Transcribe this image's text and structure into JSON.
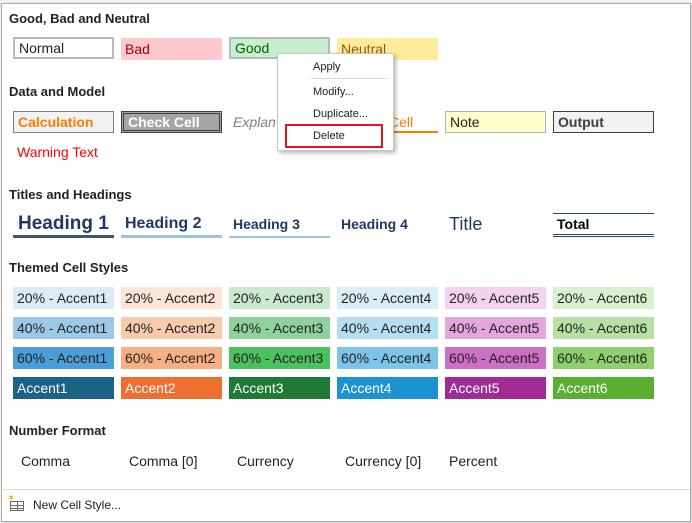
{
  "sections": {
    "good_bad_neutral": "Good, Bad and Neutral",
    "data_model": "Data and Model",
    "titles_headings": "Titles and Headings",
    "themed": "Themed Cell Styles",
    "number_format": "Number Format"
  },
  "good_bad_neutral": [
    "Normal",
    "Bad",
    "Good",
    "Neutral"
  ],
  "data_model": {
    "row1": [
      "Calculation",
      "Check Cell",
      "Explan",
      "Cell",
      "Note",
      "Output"
    ],
    "row2": [
      "Warning Text"
    ]
  },
  "titles": [
    "Heading 1",
    "Heading 2",
    "Heading 3",
    "Heading 4",
    "Title",
    "Total"
  ],
  "themed": {
    "pct20": [
      "20% - Accent1",
      "20% - Accent2",
      "20% - Accent3",
      "20% - Accent4",
      "20% - Accent5",
      "20% - Accent6"
    ],
    "pct40": [
      "40% - Accent1",
      "40% - Accent2",
      "40% - Accent3",
      "40% - Accent4",
      "40% - Accent5",
      "40% - Accent6"
    ],
    "pct60": [
      "60% - Accent1",
      "60% - Accent2",
      "60% - Accent3",
      "60% - Accent4",
      "60% - Accent5",
      "60% - Accent6"
    ],
    "accent": [
      "Accent1",
      "Accent2",
      "Accent3",
      "Accent4",
      "Accent5",
      "Accent6"
    ]
  },
  "number_format": [
    "Comma",
    "Comma [0]",
    "Currency",
    "Currency [0]",
    "Percent"
  ],
  "footer": {
    "new_style": "New Cell Style..."
  },
  "context_menu": {
    "items": [
      "Apply",
      "Modify...",
      "Duplicate...",
      "Delete"
    ],
    "highlighted": "Delete",
    "highlight_color": "#d9191e"
  },
  "colors": {
    "accent1": "#1b6286",
    "accent2": "#ed7031",
    "accent3": "#1f7a36",
    "accent4": "#1b93d1",
    "accent5": "#a02b94",
    "accent6": "#5aae30"
  }
}
